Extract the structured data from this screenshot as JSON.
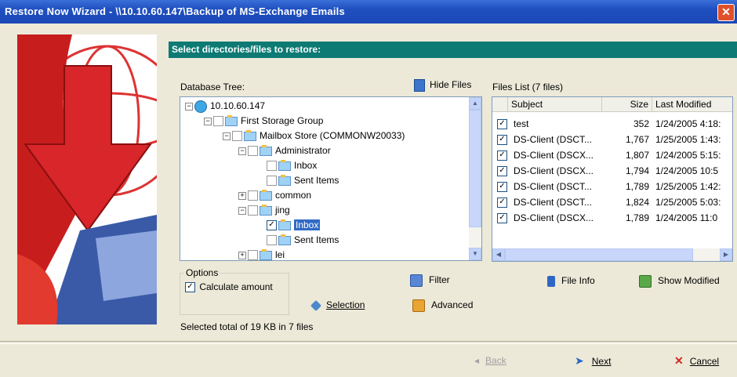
{
  "window": {
    "title": "Restore Now Wizard - \\\\10.10.60.147\\Backup of MS-Exchange Emails",
    "close_glyph": "✕"
  },
  "header": {
    "title": "Select directories/files to restore:"
  },
  "tree": {
    "label": "Database Tree:",
    "hide_files_label": "Hide Files",
    "items": [
      {
        "label": "10.10.60.147"
      },
      {
        "label": "First Storage Group"
      },
      {
        "label": "Mailbox Store (COMMONW20033)"
      },
      {
        "label": "Administrator"
      },
      {
        "label": "Inbox"
      },
      {
        "label": "Sent Items"
      },
      {
        "label": "common"
      },
      {
        "label": "jing"
      },
      {
        "label": "Inbox"
      },
      {
        "label": "Sent Items"
      },
      {
        "label": "lei"
      }
    ]
  },
  "files": {
    "label": "Files List (7 files)",
    "columns": [
      "Subject",
      "Size",
      "Last Modified"
    ],
    "rows": [
      {
        "subject": "test",
        "size": "352",
        "modified": "1/24/2005 4:18:"
      },
      {
        "subject": "DS-Client (DSCT...",
        "size": "1,767",
        "modified": "1/25/2005 1:43:"
      },
      {
        "subject": "DS-Client (DSCX...",
        "size": "1,807",
        "modified": "1/24/2005 5:15:"
      },
      {
        "subject": "DS-Client (DSCX...",
        "size": "1,794",
        "modified": "1/24/2005 10:5"
      },
      {
        "subject": "DS-Client (DSCT...",
        "size": "1,789",
        "modified": "1/25/2005 1:42:"
      },
      {
        "subject": "DS-Client (DSCT...",
        "size": "1,824",
        "modified": "1/25/2005 5:03:"
      },
      {
        "subject": "DS-Client (DSCX...",
        "size": "1,789",
        "modified": "1/24/2005 11:0"
      }
    ]
  },
  "options": {
    "legend": "Options",
    "calculate_amount": "Calculate amount"
  },
  "actions": {
    "filter": "Filter",
    "selection": "Selection",
    "advanced": "Advanced",
    "file_info": "File Info",
    "show_modified": "Show Modified"
  },
  "status": "Selected total of 19 KB in 7 files",
  "nav": {
    "back": "Back",
    "next": "Next",
    "cancel": "Cancel"
  },
  "colors": {
    "header_bg": "#0d7a73",
    "titlebar": "#1f4fc0",
    "selection": "#316ac5",
    "window_bg": "#ece9d8"
  }
}
